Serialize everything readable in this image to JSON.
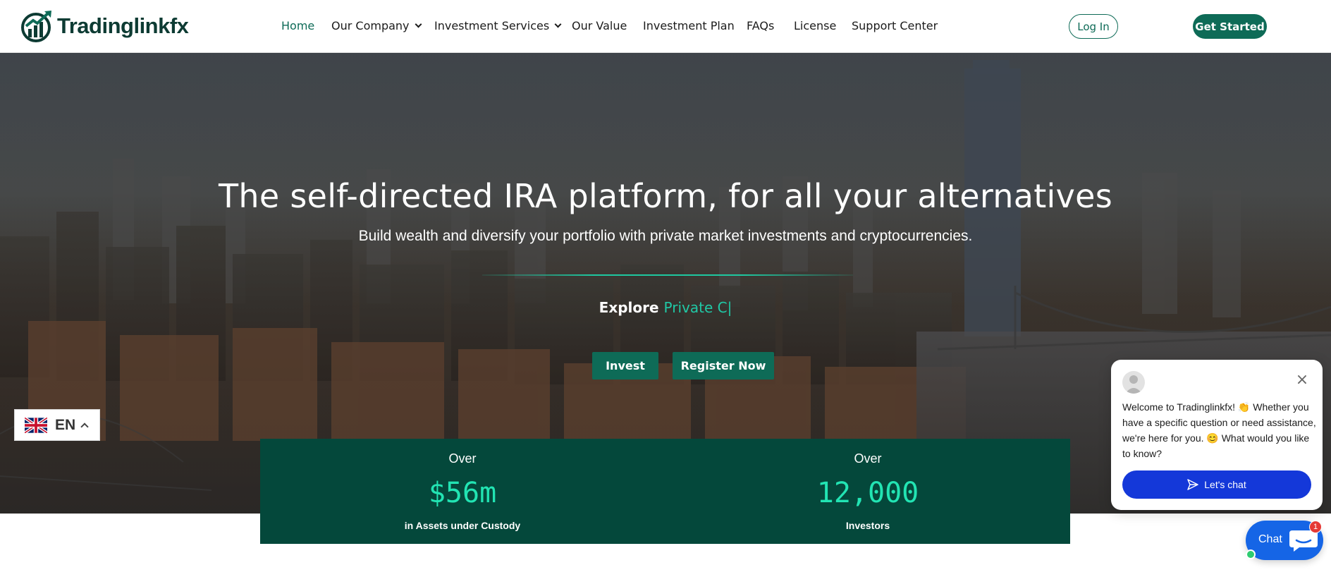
{
  "brand": {
    "name": "Tradinglinkfx"
  },
  "nav": {
    "items": [
      {
        "label": "Home",
        "active": true
      },
      {
        "label": "Our Company",
        "dropdown": true
      },
      {
        "label": "Investment Services",
        "dropdown": true
      },
      {
        "label": "Our Value"
      },
      {
        "label": "Investment Plan"
      },
      {
        "label": "FAQs"
      },
      {
        "label": "License"
      },
      {
        "label": "Support Center"
      }
    ],
    "login_label": "Log In",
    "get_started_label": "Get Started"
  },
  "hero": {
    "title": "The self-directed IRA platform, for all your alternatives",
    "subtitle": "Build wealth and diversify your portfolio with private market investments and cryptocurrencies.",
    "explore_prefix": "Explore",
    "explore_highlight": "Private C|",
    "invest_label": "Invest",
    "register_label": "Register Now"
  },
  "stats": [
    {
      "over": "Over",
      "value": "$56m",
      "caption": "in Assets under Custody"
    },
    {
      "over": "Over",
      "value": "12,000",
      "caption": "Investors"
    }
  ],
  "language": {
    "code": "EN",
    "icon": "uk-flag-icon"
  },
  "chat": {
    "message": "Welcome to Tradinglinkfx! 👏 Whether you have a specific question or need assistance, we're here for you. 😊 What would you like to know?",
    "cta_label": "Let's chat",
    "launcher_label": "Chat",
    "badge_count": "1"
  },
  "colors": {
    "brand": "#0e6b57",
    "stats_bg": "#04483b",
    "stats_value": "#22e4b3",
    "highlight": "#20c9a6",
    "chat_blue": "#1438d9"
  }
}
